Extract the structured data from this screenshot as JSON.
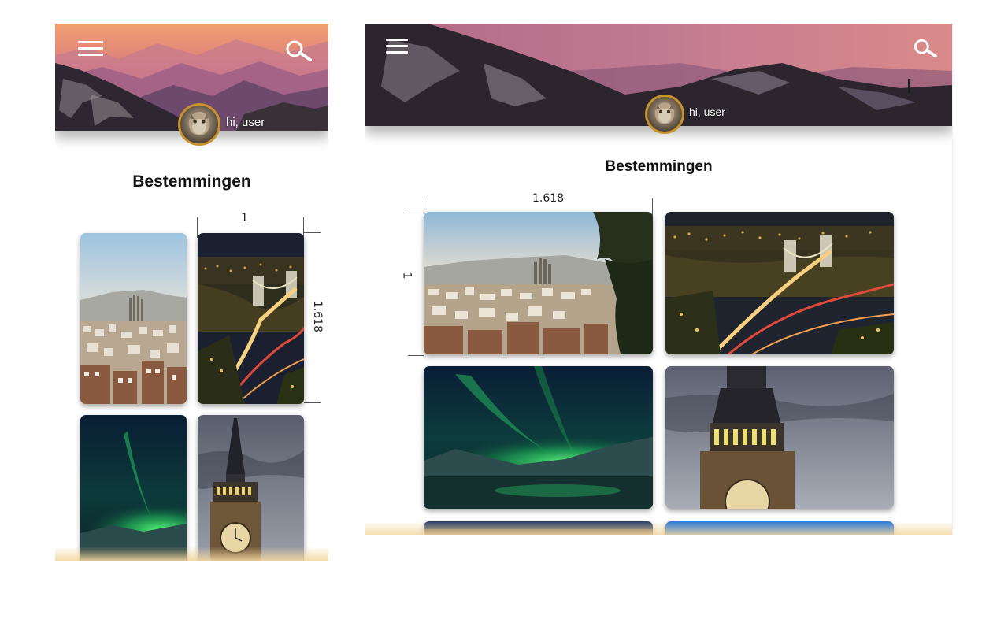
{
  "app": {
    "greeting": "hi, user",
    "page_title": "Bestemmingen"
  },
  "icons": {
    "menu": "hamburger-menu-icon",
    "search": "magnifier-search-icon",
    "avatar": "user-avatar"
  },
  "annotations": {
    "portrait_width_ratio": "1",
    "portrait_height_ratio": "1.618",
    "landscape_width_ratio": "1.618",
    "landscape_height_ratio": "1"
  },
  "destinations": [
    {
      "id": "barcelona",
      "scene": "city-skyline-cathedral"
    },
    {
      "id": "budapest",
      "scene": "chain-bridge-night"
    },
    {
      "id": "aurora",
      "scene": "northern-lights-lake"
    },
    {
      "id": "london",
      "scene": "big-ben-clock-tower"
    }
  ],
  "colors": {
    "avatar_ring": "#c8922c",
    "title_text": "#111111",
    "aurora_green": "#2fd86a",
    "sky_sunset": "#e98a6a"
  }
}
